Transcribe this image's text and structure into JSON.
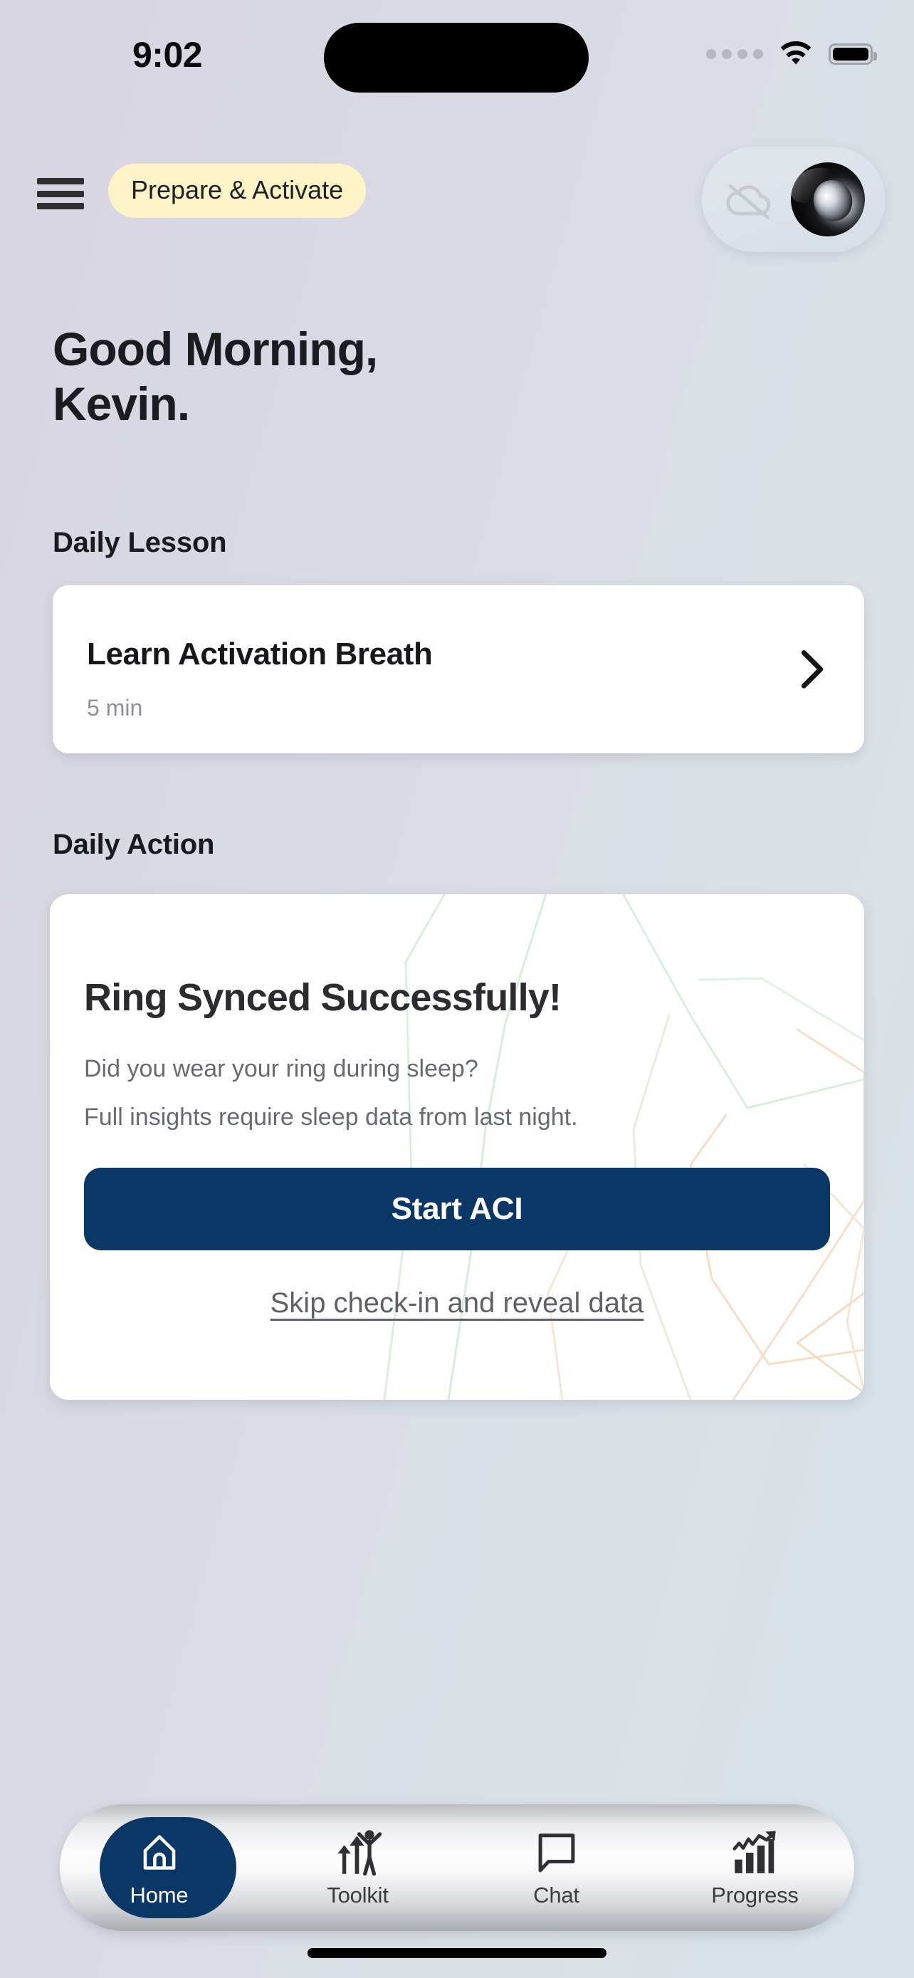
{
  "status_bar": {
    "time": "9:02",
    "cellular_icon": "cellular-dots-icon",
    "wifi_icon": "wifi-icon",
    "battery_icon": "battery-full-icon",
    "dynamic_island": "dynamic-island"
  },
  "header": {
    "menu_icon": "hamburger-menu-icon",
    "phase_label": "Prepare & Activate",
    "sync_status_icon": "cloud-off-icon",
    "ring_image": "smart-ring-image"
  },
  "greeting": {
    "line1": "Good Morning,",
    "line2": "Kevin."
  },
  "daily_lesson": {
    "section_label": "Daily Lesson",
    "title": "Learn Activation Breath",
    "duration": "5 min",
    "chevron_icon": "chevron-right-icon"
  },
  "daily_action": {
    "section_label": "Daily Action",
    "title": "Ring Synced Successfully!",
    "body_line1": "Did you wear your ring during sleep?",
    "body_line2": "Full insights require sleep data from last night.",
    "primary_button": "Start ACI",
    "skip_link": "Skip check-in and reveal data"
  },
  "bottom_nav": {
    "items": [
      {
        "label": "Home",
        "icon": "home-icon",
        "active": true
      },
      {
        "label": "Toolkit",
        "icon": "toolkit-icon",
        "active": false
      },
      {
        "label": "Chat",
        "icon": "chat-icon",
        "active": false
      },
      {
        "label": "Progress",
        "icon": "progress-icon",
        "active": false
      }
    ]
  },
  "colors": {
    "brand_navy": "#0b3767",
    "phase_pill_bg": "#fdf3c6",
    "card_bg": "#ffffff",
    "page_bg_left": "#d7d5e1",
    "page_bg_right": "#d8e3e9",
    "muted_text": "#666b71",
    "deco_green": "#d8f0dd",
    "deco_peach": "#f6ddc6"
  }
}
